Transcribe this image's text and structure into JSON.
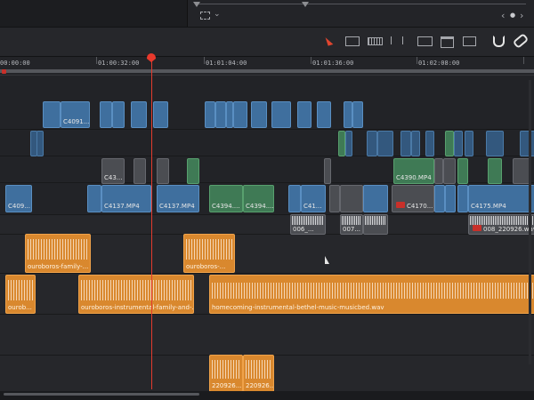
{
  "ruler": {
    "timecodes": [
      "00:00:00",
      "01:00:32:00",
      "01:01:04:00",
      "01:01:36:00",
      "01:02:08:00"
    ]
  },
  "viewer": {
    "nav_prev": "‹",
    "nav_dot": "●",
    "nav_next": "›"
  },
  "toolbar": {
    "icons": [
      "select-pointer-icon",
      "trim-edit-icon",
      "dynamic-trim-icon",
      "blade-icon",
      "insert-clip-icon",
      "overwrite-clip-icon",
      "replace-clip-icon",
      "snapping-icon",
      "linked-selection-icon"
    ]
  },
  "video_clips": {
    "v4": [
      "C4091...",
      "C4390.MP4"
    ],
    "v3_labels": [
      "C43..."
    ],
    "v1": [
      "C409...",
      "C4137.MP4",
      "C4137.MP4",
      "C4394....",
      "C4394....",
      "C41...",
      "C4170...",
      "C4175.MP4"
    ]
  },
  "audio_clips": {
    "a0": [
      "006_...",
      "007...",
      "008_220926.wav"
    ],
    "a1": [
      "ouroboros-family-...",
      "ouroboros-..."
    ],
    "a2": [
      "ourob...",
      "ouroboros-instrumental-family-and-...",
      "homecoming-instrumental-bethel-music-musicbed.wav"
    ],
    "a3": [
      "220926...",
      "220926..."
    ]
  },
  "colors": {
    "playhead": "#e23b2e",
    "video_clip": "#3f6f9e",
    "video_clip_green": "#3f7a55",
    "audio_clip": "#d9882e"
  }
}
